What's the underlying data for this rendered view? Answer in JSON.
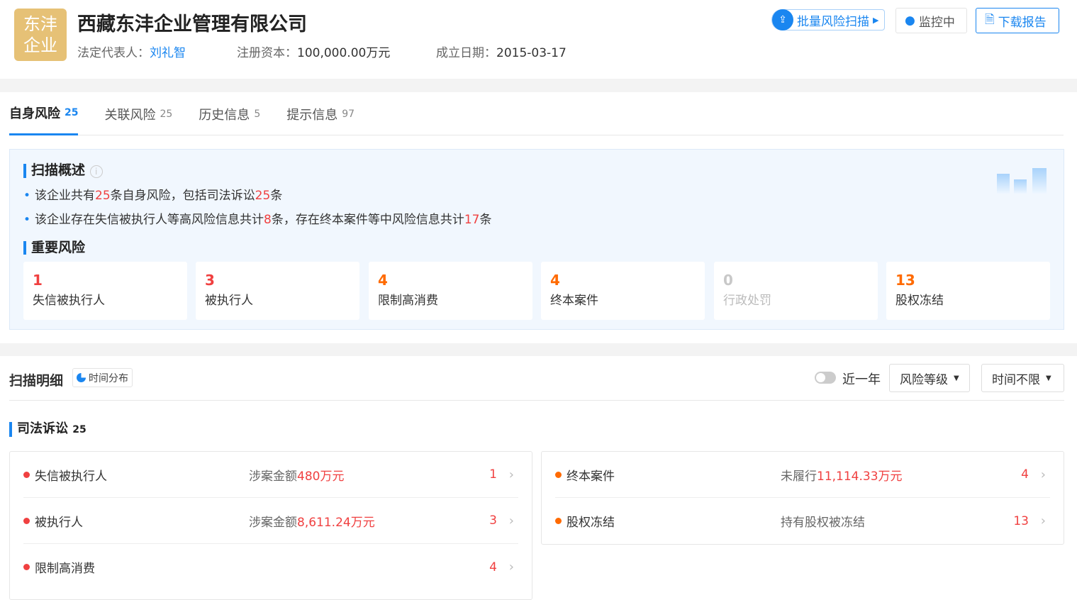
{
  "company": {
    "logo_text": "东沣企业",
    "name": "西藏东沣企业管理有限公司",
    "legal_rep_label": "法定代表人：",
    "legal_rep": "刘礼智",
    "capital_label": "注册资本：",
    "capital": "100,000.00万元",
    "founded_label": "成立日期：",
    "founded": "2015-03-17"
  },
  "actions": {
    "batch_scan": "批量风险扫描",
    "monitor": "监控中",
    "download": "下载报告"
  },
  "tabs": [
    {
      "label": "自身风险",
      "count": "25"
    },
    {
      "label": "关联风险",
      "count": "25"
    },
    {
      "label": "历史信息",
      "count": "5"
    },
    {
      "label": "提示信息",
      "count": "97"
    }
  ],
  "summary": {
    "title": "扫描概述",
    "line1": {
      "a": "该企业共有",
      "b": "25",
      "c": "条自身风险，包括司法诉讼",
      "d": "25",
      "e": "条"
    },
    "line2": {
      "a": "该企业存在失信被执行人等高风险信息共计",
      "b": "8",
      "c": "条，存在终本案件等中风险信息共计",
      "d": "17",
      "e": "条"
    },
    "important_title": "重要风险",
    "cards": [
      {
        "n": "1",
        "label": "失信被执行人",
        "color": "#f04040"
      },
      {
        "n": "3",
        "label": "被执行人",
        "color": "#f04040"
      },
      {
        "n": "4",
        "label": "限制高消费",
        "color": "#ff6a00"
      },
      {
        "n": "4",
        "label": "终本案件",
        "color": "#ff6a00"
      },
      {
        "n": "0",
        "label": "行政处罚",
        "color": "#c8c8c8"
      },
      {
        "n": "13",
        "label": "股权冻结",
        "color": "#ff6a00"
      }
    ]
  },
  "detail": {
    "title": "扫描明细",
    "time_dist": "时间分布",
    "toggle_label": "近一年",
    "toggle_on": false,
    "risk_level": "风险等级",
    "time_range": "时间不限",
    "section": "司法诉讼",
    "section_count": "25",
    "left": [
      {
        "label": "失信被执行人",
        "desc": "涉案金额",
        "amount": "480万元",
        "count": "1"
      },
      {
        "label": "被执行人",
        "desc": "涉案金额",
        "amount": "8,611.24万元",
        "count": "3"
      },
      {
        "label": "限制高消费",
        "desc": "",
        "amount": "",
        "count": "4"
      }
    ],
    "right": [
      {
        "label": "终本案件",
        "desc": "未履行",
        "amount": "11,114.33万元",
        "count": "4"
      },
      {
        "label": "股权冻结",
        "desc": "持有股权被冻结",
        "amount": "",
        "count": "13"
      }
    ]
  }
}
